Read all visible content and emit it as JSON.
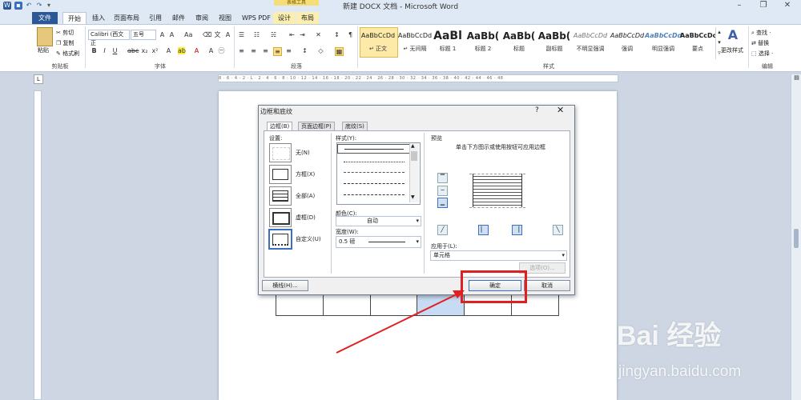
{
  "window": {
    "title": "新建 DOCX 文档 - Microsoft Word",
    "context_tab_group": "表格工具"
  },
  "tabs": [
    "文件",
    "开始",
    "插入",
    "页面布局",
    "引用",
    "邮件",
    "审阅",
    "视图",
    "WPS PDF",
    "设计",
    "布局"
  ],
  "ribbon": {
    "clipboard": {
      "paste": "粘贴",
      "cut": "剪切",
      "copy": "复制",
      "format_painter": "格式刷",
      "label": "剪贴板"
    },
    "font": {
      "name": "Calibri (西文正",
      "size": "五号",
      "label": "字体"
    },
    "paragraph": {
      "label": "段落"
    },
    "styles": {
      "items": [
        {
          "sample": "AaBbCcDd",
          "name": "↵ 正文"
        },
        {
          "sample": "AaBbCcDd",
          "name": "↵ 无间隔"
        },
        {
          "sample": "AaBl",
          "name": "标题 1"
        },
        {
          "sample": "AaBb(",
          "name": "标题 2"
        },
        {
          "sample": "AaBb(",
          "name": "标题"
        },
        {
          "sample": "AaBb(",
          "name": "副标题"
        },
        {
          "sample": "AaBbCcDd",
          "name": "不明显强调"
        },
        {
          "sample": "AaBbCcDd",
          "name": "强调"
        },
        {
          "sample": "AaBbCcDd",
          "name": "明显强调"
        },
        {
          "sample": "AaBbCcDc",
          "name": "要点"
        }
      ],
      "change_styles": "更改样式",
      "label": "样式"
    },
    "editing": {
      "find": "查找 ·",
      "replace": "替换",
      "select": "选择 ·",
      "label": "编辑"
    }
  },
  "ruler_text": "8 · 6 · 4 · 2 · L · 2 · 4 · 6 · 8 · 10 · 12 · 14 · 16 · 18 · 20 · 22 · 24 · 26 · 28 · 30 · 32 · 34 · 36 · 38 · 40 · 42 · 44 · 46 · 48",
  "dialog": {
    "title": "边框和底纹",
    "help": "?",
    "close": "✕",
    "tabs": [
      "边框(B)",
      "页面边框(P)",
      "底纹(S)"
    ],
    "settings_label": "设置:",
    "settings": [
      "无(N)",
      "方框(X)",
      "全部(A)",
      "虚框(D)",
      "自定义(U)"
    ],
    "style_label": "样式(Y):",
    "color_label": "颜色(C):",
    "color_value": "自动",
    "width_label": "宽度(W):",
    "width_value": "0.5 磅",
    "preview_label": "预览",
    "preview_hint": "单击下方图示或使用按钮可应用边框",
    "apply_label": "应用于(L):",
    "apply_value": "单元格",
    "options_button": "选项(O)...",
    "hline_button": "横线(H)...",
    "ok_button": "确定",
    "cancel_button": "取消"
  },
  "watermark": {
    "brand": "Bai 经验",
    "url": "jingyan.baidu.com"
  },
  "colors": {
    "accent": "#2b5797",
    "highlight": "#e02020",
    "ctx_tab": "#f6de76"
  }
}
